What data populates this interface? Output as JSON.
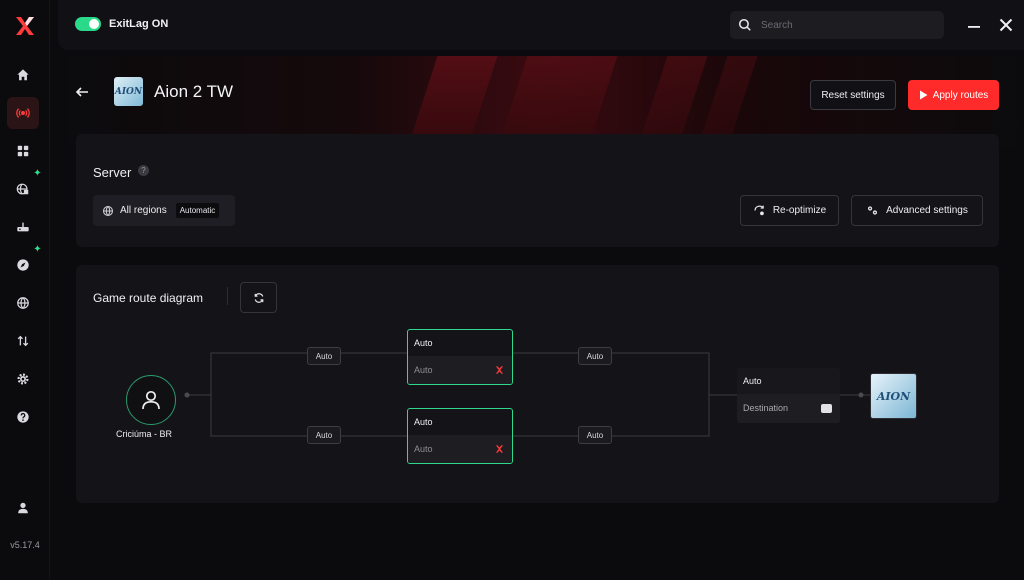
{
  "app": {
    "version": "v5.17.4"
  },
  "topbar": {
    "toggle_label": "ExitLag ON",
    "search_placeholder": "Search"
  },
  "header": {
    "game_title": "Aion 2 TW",
    "game_icon_text": "AION",
    "reset_label": "Reset settings",
    "apply_label": "Apply routes"
  },
  "colors": {
    "accent": "#ff2a2a",
    "active_green": "#2fd88f",
    "toggle": "#2ad98a"
  },
  "sidebar": {
    "items": [
      {
        "name": "home-icon",
        "active": false
      },
      {
        "name": "broadcast-icon",
        "active": true
      },
      {
        "name": "grid-icon",
        "active": false
      },
      {
        "name": "globe-tools-icon",
        "active": false,
        "badge": true
      },
      {
        "name": "router-icon",
        "active": false
      },
      {
        "name": "compass-icon",
        "active": false,
        "badge": true
      },
      {
        "name": "network-globe-icon",
        "active": false
      },
      {
        "name": "transfer-icon",
        "active": false
      },
      {
        "name": "gear-icon",
        "active": false
      },
      {
        "name": "help-icon",
        "active": false
      },
      {
        "name": "user-icon",
        "active": false
      }
    ]
  },
  "server": {
    "label": "Server",
    "help": "?",
    "region_name": "All regions",
    "region_tag": "Automatic",
    "reoptimize_label": "Re-optimize",
    "advanced_label": "Advanced settings"
  },
  "diagram": {
    "title": "Game route diagram",
    "user_label": "Criciúma - BR",
    "pills": {
      "a": "Auto",
      "b": "Auto",
      "c": "Auto",
      "d": "Auto"
    },
    "node_top": {
      "title": "Auto",
      "value": "Auto"
    },
    "node_bottom": {
      "title": "Auto",
      "value": "Auto"
    },
    "dest": {
      "title": "Auto",
      "value": "Destination"
    },
    "game_icon_text": "AION"
  }
}
